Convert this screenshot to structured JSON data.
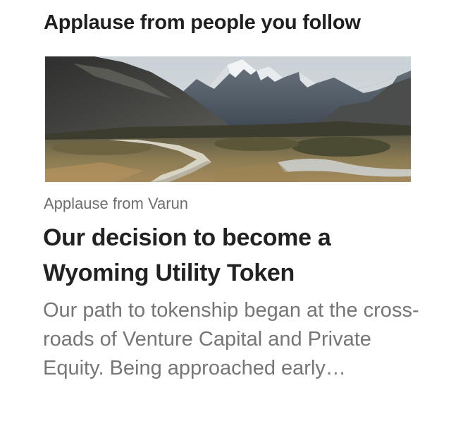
{
  "section": {
    "title": "Applause from people you follow"
  },
  "story": {
    "image_icon": "mountain-landscape-image",
    "applause_from": "Applause from Varun",
    "title": "Our decision to become a Wyoming Utility Token",
    "excerpt": "Our path to tokenship began at the cross-roads of Venture Capital and Private Equity. Being approached early…"
  },
  "colors": {
    "title_text": "#222222",
    "meta_text": "#6e6e6e",
    "excerpt_text": "#767676",
    "background": "#ffffff"
  }
}
